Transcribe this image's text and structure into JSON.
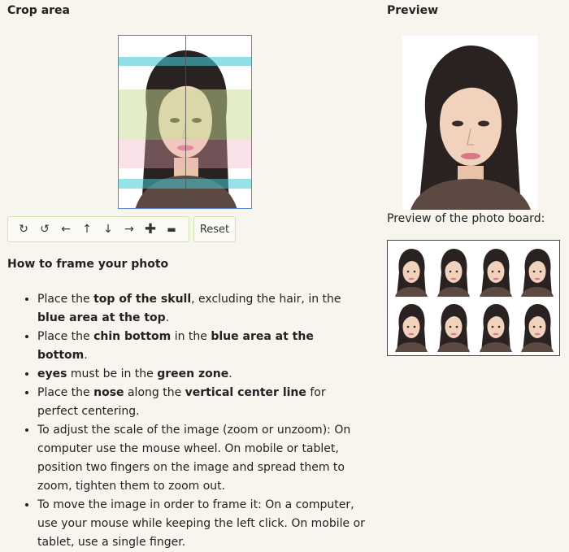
{
  "crop_area": {
    "title": "Crop area"
  },
  "toolbar": {
    "rotate_right_icon": "↻",
    "rotate_left_icon": "↺",
    "move_left_icon": "←",
    "move_up_icon": "↑",
    "move_down_icon": "↓",
    "move_right_icon": "→",
    "zoom_in_icon": "✚",
    "zoom_out_icon": "▬",
    "reset_label": "Reset"
  },
  "preview": {
    "title": "Preview",
    "board_label": "Preview of the photo board:"
  },
  "instructions": {
    "title": "How to frame your photo",
    "items": [
      {
        "a": "Place the ",
        "b": "top of the skull",
        "c": ", excluding the hair, in the ",
        "d": "blue area at the top",
        "e": "."
      },
      {
        "a": "Place the ",
        "b": "chin bottom",
        "c": " in the ",
        "d": "blue area at the bottom",
        "e": "."
      },
      {
        "a": "",
        "b": "eyes",
        "c": " must be in the ",
        "d": "green zone",
        "e": "."
      },
      {
        "a": "Place the ",
        "b": "nose",
        "c": " along the ",
        "d": "vertical center line",
        "e": " for perfect centering."
      },
      {
        "text": "To adjust the scale of the image (zoom or unzoom): On computer use the mouse wheel. On mobile or tablet, position two fingers on the image and spread them to zoom, tighten them to zoom out."
      },
      {
        "text": "To move the image in order to frame it: On a computer, use your mouse while keeping the left click. On mobile or tablet, use a single finger."
      }
    ]
  }
}
